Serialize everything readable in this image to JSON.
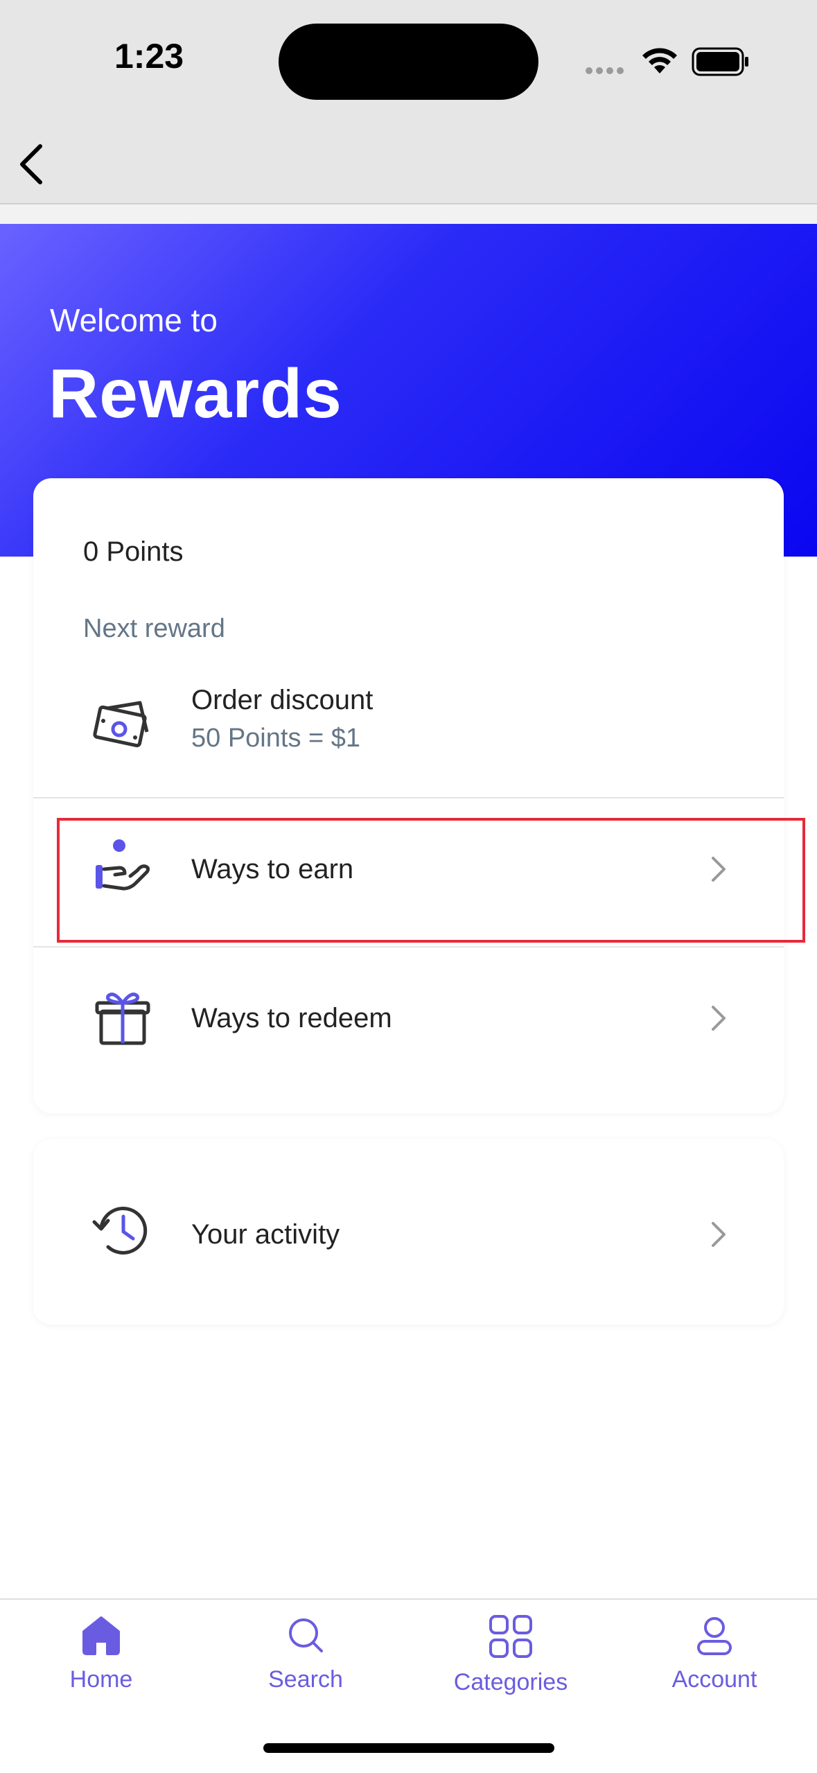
{
  "status_bar": {
    "time": "1:23"
  },
  "hero": {
    "welcome": "Welcome to",
    "title": "Rewards"
  },
  "points_card": {
    "points": "0 Points",
    "next_reward_label": "Next reward",
    "reward_name": "Order discount",
    "reward_rate": "50 Points = $1"
  },
  "menu": {
    "earn_label": "Ways to earn",
    "redeem_label": "Ways to redeem",
    "activity_label": "Your activity"
  },
  "tabbar": {
    "items": [
      {
        "label": "Home"
      },
      {
        "label": "Search"
      },
      {
        "label": "Categories"
      },
      {
        "label": "Account"
      }
    ]
  },
  "colors": {
    "accent": "#6a5ce0",
    "hero_gradient_start": "#6a62ff",
    "hero_gradient_end": "#0a06f0",
    "highlight": "#e52a3a",
    "muted_text": "#647586"
  }
}
